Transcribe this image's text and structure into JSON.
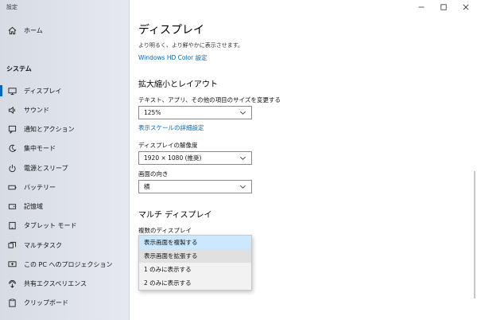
{
  "window": {
    "title": "設定"
  },
  "sidebar": {
    "home_label": "ホーム",
    "section_label": "システム",
    "items": [
      {
        "label": "ディスプレイ",
        "icon": "monitor-icon"
      },
      {
        "label": "サウンド",
        "icon": "speaker-icon"
      },
      {
        "label": "通知とアクション",
        "icon": "notification-icon"
      },
      {
        "label": "集中モード",
        "icon": "moon-icon"
      },
      {
        "label": "電源とスリープ",
        "icon": "power-icon"
      },
      {
        "label": "バッテリー",
        "icon": "battery-icon"
      },
      {
        "label": "記憶域",
        "icon": "storage-icon"
      },
      {
        "label": "タブレット モード",
        "icon": "tablet-icon"
      },
      {
        "label": "マルチタスク",
        "icon": "multitask-icon"
      },
      {
        "label": "この PC へのプロジェクション",
        "icon": "projection-icon"
      },
      {
        "label": "共有エクスペリエンス",
        "icon": "share-icon"
      },
      {
        "label": "クリップボード",
        "icon": "clipboard-icon"
      }
    ],
    "accent": "#0067c0"
  },
  "main": {
    "page_title": "ディスプレイ",
    "desc_line1": "より明るく、より鮮やかに表示させます。",
    "hdr_link": "Windows HD Color 設定",
    "scale_heading": "拡大縮小とレイアウト",
    "scale_label": "テキスト、アプリ、その他の項目のサイズを変更する",
    "scale_value": "125%",
    "scale_link": "表示スケールの詳細設定",
    "resolution_label": "ディスプレイの解像度",
    "resolution_value": "1920 × 1080 (推奨)",
    "orientation_label": "画面の向き",
    "orientation_value": "横",
    "multi_heading": "マルチ ディスプレイ",
    "multi_label": "複数のディスプレイ",
    "multi_options": [
      "表示画面を複製する",
      "表示画面を拡張する",
      "1 のみに表示する",
      "2 のみに表示する"
    ]
  }
}
